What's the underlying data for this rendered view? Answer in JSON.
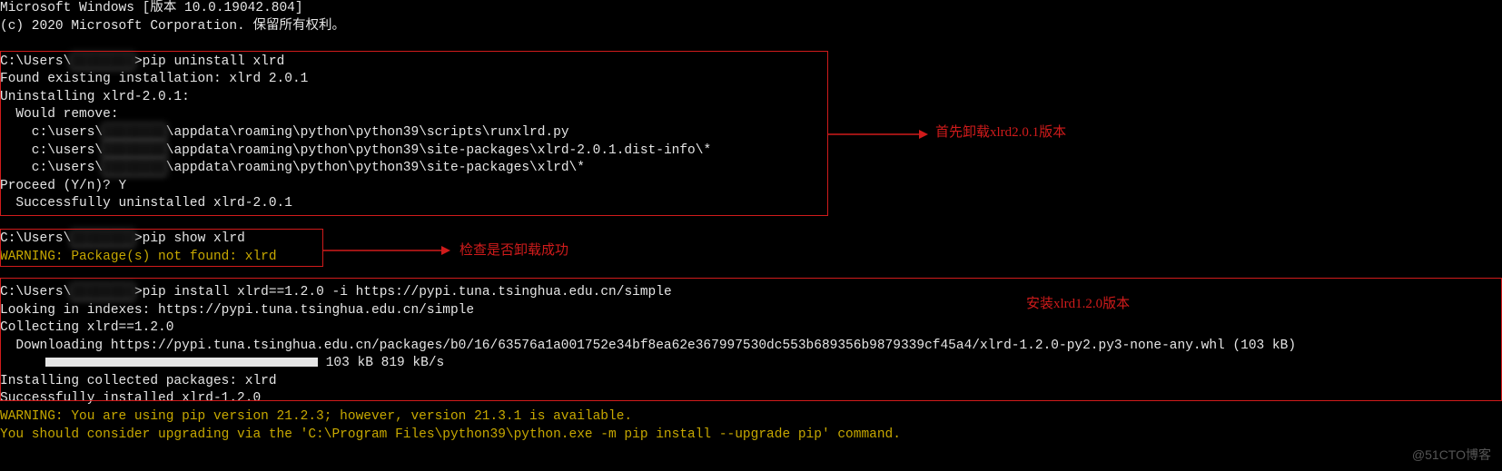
{
  "header": {
    "version_line": "Microsoft Windows [版本 10.0.19042.804]",
    "copyright_line": "(c) 2020 Microsoft Corporation. 保留所有权利。"
  },
  "block1": {
    "prompt_prefix": "C:\\Users\\",
    "prompt_hidden": "████████",
    "prompt_suffix": ">pip uninstall xlrd",
    "l2": "Found existing installation: xlrd 2.0.1",
    "l3": "Uninstalling xlrd-2.0.1:",
    "l4": "  Would remove:",
    "l5a": "    c:\\users\\",
    "l5h": "████████",
    "l5b": "\\appdata\\roaming\\python\\python39\\scripts\\runxlrd.py",
    "l6a": "    c:\\users\\",
    "l6h": "████████",
    "l6b": "\\appdata\\roaming\\python\\python39\\site-packages\\xlrd-2.0.1.dist-info\\*",
    "l7a": "    c:\\users\\",
    "l7h": "████████",
    "l7b": "\\appdata\\roaming\\python\\python39\\site-packages\\xlrd\\*",
    "l8": "Proceed (Y/n)? Y",
    "l9": "  Successfully uninstalled xlrd-2.0.1"
  },
  "block2": {
    "prompt_prefix": "C:\\Users\\",
    "prompt_hidden": "████████",
    "prompt_suffix": ">pip show xlrd",
    "warn": "WARNING: Package(s) not found: xlrd"
  },
  "block3": {
    "prompt_prefix": "C:\\Users\\",
    "prompt_hidden": "████████",
    "prompt_suffix": ">pip install xlrd==1.2.0 -i https://pypi.tuna.tsinghua.edu.cn/simple",
    "l2": "Looking in indexes: https://pypi.tuna.tsinghua.edu.cn/simple",
    "l3": "Collecting xlrd==1.2.0",
    "l4": "  Downloading https://pypi.tuna.tsinghua.edu.cn/packages/b0/16/63576a1a001752e34bf8ea62e367997530dc553b689356b9879339cf45a4/xlrd-1.2.0-py2.py3-none-any.whl (103 kB)",
    "l5_progress": " 103 kB 819 kB/s",
    "l6": "Installing collected packages: xlrd",
    "l7": "Successfully installed xlrd-1.2.0",
    "warn": "WARNING: You are using pip version 21.2.3; however, version 21.3.1 is available.",
    "l9": "You should consider upgrading via the 'C:\\Program Files\\python39\\python.exe -m pip install --upgrade pip' command."
  },
  "annotations": {
    "a1": "首先卸载xlrd2.0.1版本",
    "a2": "检查是否卸载成功",
    "a3": "安装xlrd1.2.0版本"
  },
  "watermark": "@51CTO博客"
}
